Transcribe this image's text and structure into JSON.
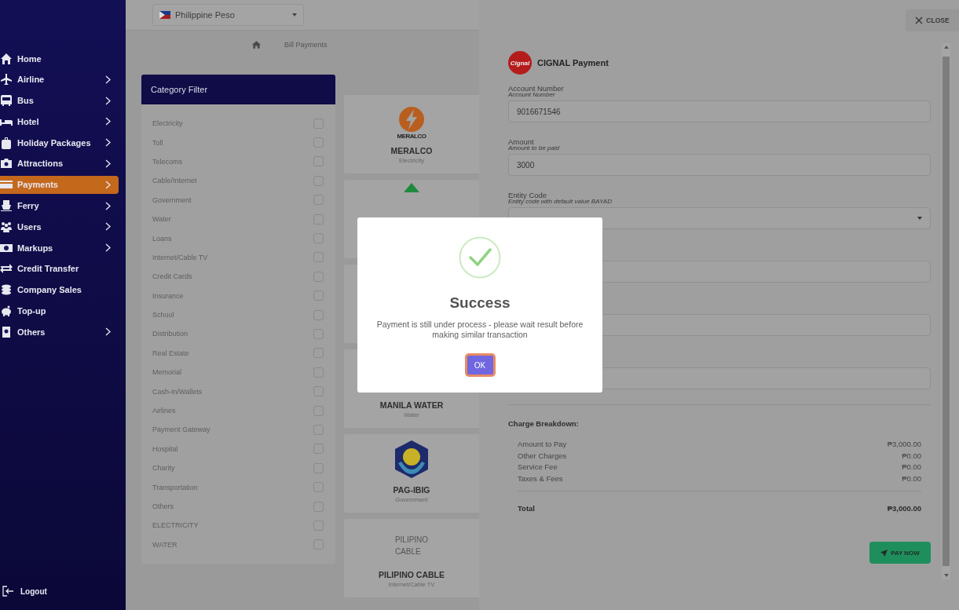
{
  "sidebar": {
    "items": [
      {
        "label": "Home",
        "has_submenu": false,
        "selected": false
      },
      {
        "label": "Airline",
        "has_submenu": true,
        "selected": false
      },
      {
        "label": "Bus",
        "has_submenu": true,
        "selected": false
      },
      {
        "label": "Hotel",
        "has_submenu": true,
        "selected": false
      },
      {
        "label": "Holiday Packages",
        "has_submenu": true,
        "selected": false
      },
      {
        "label": "Attractions",
        "has_submenu": true,
        "selected": false
      },
      {
        "label": "Payments",
        "has_submenu": true,
        "selected": true
      },
      {
        "label": "Ferry",
        "has_submenu": true,
        "selected": false
      },
      {
        "label": "Users",
        "has_submenu": true,
        "selected": false
      },
      {
        "label": "Markups",
        "has_submenu": true,
        "selected": false
      },
      {
        "label": "Credit Transfer",
        "has_submenu": false,
        "selected": false
      },
      {
        "label": "Company Sales",
        "has_submenu": false,
        "selected": false
      },
      {
        "label": "Top-up",
        "has_submenu": false,
        "selected": false
      },
      {
        "label": "Others",
        "has_submenu": true,
        "selected": false
      }
    ],
    "logout": "Logout"
  },
  "currency": {
    "value": "Philippine Peso"
  },
  "breadcrumb": {
    "current": "Bill Payments"
  },
  "category_filter": {
    "title": "Category Filter",
    "items": [
      {
        "label": "Electricity",
        "checked": false
      },
      {
        "label": "Toll",
        "checked": false
      },
      {
        "label": "Telecoms",
        "checked": false
      },
      {
        "label": "Cable/Internet",
        "checked": false
      },
      {
        "label": "Government",
        "checked": false
      },
      {
        "label": "Water",
        "checked": false
      },
      {
        "label": "Loans",
        "checked": false
      },
      {
        "label": "Internet/Cable TV",
        "checked": false
      },
      {
        "label": "Credit Cards",
        "checked": false
      },
      {
        "label": "Insurance",
        "checked": false
      },
      {
        "label": "School",
        "checked": false
      },
      {
        "label": "Distribution",
        "checked": false
      },
      {
        "label": "Real Estate",
        "checked": false
      },
      {
        "label": "Memorial",
        "checked": false
      },
      {
        "label": "Cash-In/Wallets",
        "checked": false
      },
      {
        "label": "Airlines",
        "checked": false
      },
      {
        "label": "Payment Gateway",
        "checked": false
      },
      {
        "label": "Hospital",
        "checked": false
      },
      {
        "label": "Charity",
        "checked": false
      },
      {
        "label": "Transportation",
        "checked": false
      },
      {
        "label": "Others",
        "checked": false
      },
      {
        "label": "ELECTRICITY",
        "checked": false
      },
      {
        "label": "WATER",
        "checked": false
      }
    ]
  },
  "billers": [
    {
      "kind": "named",
      "logo_text": "MERALCO",
      "name": "MERALCO",
      "category": "Electricity"
    },
    {
      "kind": "covered"
    },
    {
      "kind": "covered"
    },
    {
      "kind": "named",
      "name": "MANILA WATER",
      "category": "Water"
    },
    {
      "kind": "named",
      "name": "PAG-IBIG",
      "category": "Government"
    },
    {
      "kind": "named",
      "logo_lines": [
        "PILIPINO",
        "CABLE"
      ],
      "name": "PILIPINO CABLE",
      "category": "Internet/Cable TV"
    }
  ],
  "payment_panel": {
    "close": "CLOSE",
    "logo_text": "Cignal",
    "title": "CIGNAL Payment",
    "fields": [
      {
        "kind": "input",
        "label": "Account Number",
        "hint": "Account Number",
        "value": "9016671546"
      },
      {
        "kind": "input",
        "label": "Amount",
        "hint": "Amount to be paid",
        "value": "3000"
      },
      {
        "kind": "select",
        "label": "Entity Code",
        "hint": "Entity code with default value BAYAD"
      },
      {
        "kind": "input"
      },
      {
        "kind": "input"
      },
      {
        "kind": "input"
      }
    ],
    "breakdown": {
      "title": "Charge Breakdown:",
      "rows": [
        {
          "label": "Amount to Pay",
          "value": "₱3,000.00"
        },
        {
          "label": "Other Charges",
          "value": "₱0.00"
        },
        {
          "label": "Service Fee",
          "value": "₱0.00"
        },
        {
          "label": "Taxes & Fees",
          "value": "₱0.00"
        }
      ],
      "total_label": "Total",
      "total_value": "₱3,000.00"
    },
    "pay_button": "PAY NOW"
  },
  "dialog": {
    "title": "Success",
    "message": "Payment is still under process - please wait result before making similar transaction",
    "ok": "OK"
  }
}
